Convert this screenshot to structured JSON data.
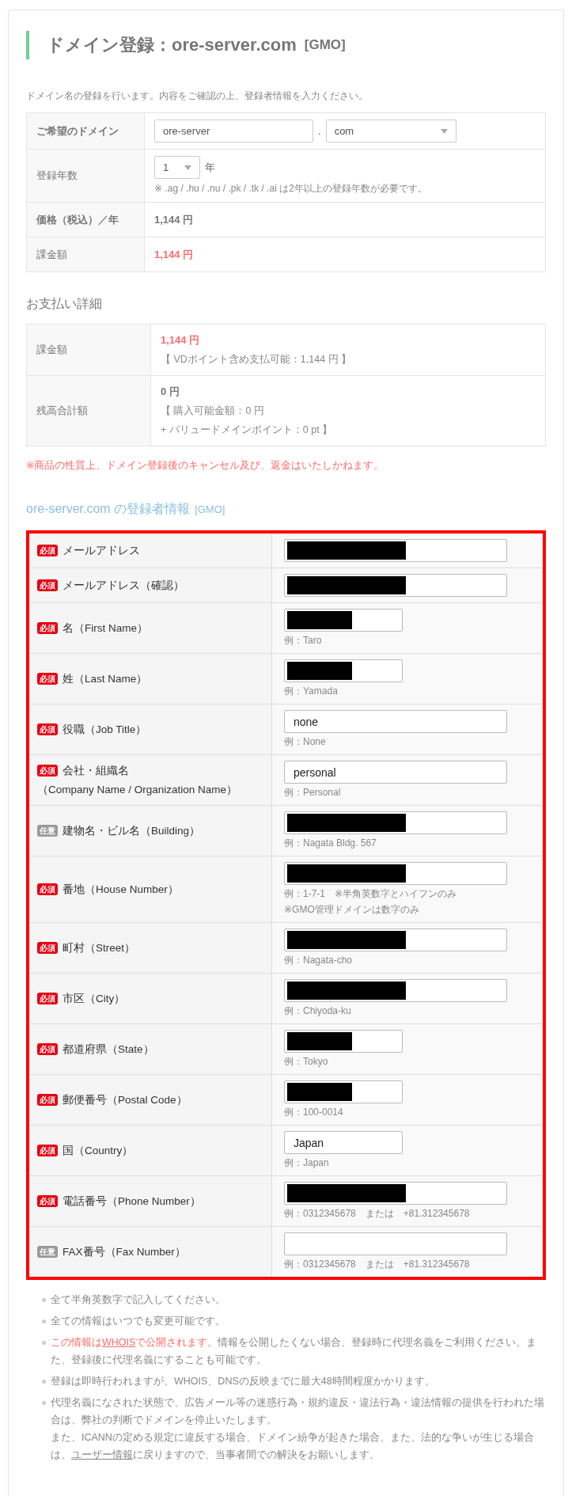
{
  "title": {
    "text": "ドメイン登録：ore-server.com",
    "tag": "[GMO]"
  },
  "intro": "ドメイン名の登録を行います。内容をご確認の上、登録者情報を入力ください。",
  "domain_table": {
    "rows": [
      {
        "kind": "domain",
        "label": "ご希望のドメイン",
        "label_bold": true,
        "name_value": "ore-server",
        "separator": ".",
        "tld_value": "com"
      },
      {
        "kind": "years",
        "label": "登録年数",
        "label_bold": false,
        "value": "1",
        "unit": "年",
        "note": "※ .ag / .hu / .nu / .pk / .tk / .ai は2年以上の登録年数が必要です。"
      },
      {
        "kind": "price",
        "label": "価格（税込）／年",
        "label_bold": true,
        "value": "1,144 円"
      },
      {
        "kind": "charge",
        "label": "課金額",
        "label_bold": false,
        "value": "1,144 円"
      }
    ]
  },
  "payment": {
    "heading": "お支払い詳細",
    "rows": [
      {
        "label": "課金額",
        "lines": [
          {
            "kind": "alert-amount",
            "text": "1,144 円"
          },
          {
            "kind": "detail",
            "text": "【 VDポイント含め支払可能：1,144 円 】"
          }
        ]
      },
      {
        "label": "残高合計額",
        "lines": [
          {
            "kind": "amount",
            "text": "0 円"
          },
          {
            "kind": "detail",
            "text": "【 購入可能金額：0 円"
          },
          {
            "kind": "detail",
            "text": "+ バリュードメインポイント：0 pt 】"
          }
        ]
      }
    ]
  },
  "warning": "※商品の性質上、ドメイン登録後のキャンセル及び、返金はいたしかねます。",
  "registrant": {
    "heading": "ore-server.com の登録者情報",
    "tag": "[GMO]",
    "fields": [
      {
        "badge": "必須",
        "required": true,
        "label": "メールアドレス",
        "kind": "long",
        "redacted": true
      },
      {
        "badge": "必須",
        "required": true,
        "label": "メールアドレス（確認）",
        "kind": "long",
        "redacted": true
      },
      {
        "badge": "必須",
        "required": true,
        "label": "名（First Name）",
        "kind": "short",
        "redacted": true,
        "hints": [
          "例：Taro"
        ]
      },
      {
        "badge": "必須",
        "required": true,
        "label": "姓（Last Name）",
        "kind": "short",
        "redacted": true,
        "hints": [
          "例：Yamada"
        ]
      },
      {
        "badge": "必須",
        "required": true,
        "label": "役職（Job Title）",
        "kind": "long",
        "redacted": false,
        "value": "none",
        "hints": [
          "例：None"
        ]
      },
      {
        "badge": "必須",
        "required": true,
        "label": "会社・組織名",
        "label_2": "（Company Name / Organization Name）",
        "kind": "long",
        "redacted": false,
        "value": "personal",
        "hints": [
          "例：Personal"
        ]
      },
      {
        "badge": "任意",
        "required": false,
        "label": "建物名・ビル名（Building）",
        "kind": "long",
        "redacted": true,
        "hints": [
          "例：Nagata Bldg. 567"
        ]
      },
      {
        "badge": "必須",
        "required": true,
        "label": "番地（House Number）",
        "kind": "long",
        "redacted": true,
        "hints": [
          "例：1-7-1　※半角英数字とハイフンのみ",
          "※GMO管理ドメインは数字のみ"
        ]
      },
      {
        "badge": "必須",
        "required": true,
        "label": "町村（Street）",
        "kind": "long",
        "redacted": true,
        "hints": [
          "例：Nagata-cho"
        ]
      },
      {
        "badge": "必須",
        "required": true,
        "label": "市区（City）",
        "kind": "long",
        "redacted": true,
        "hints": [
          "例：Chiyoda-ku"
        ]
      },
      {
        "badge": "必須",
        "required": true,
        "label": "都道府県（State）",
        "kind": "short",
        "redacted": true,
        "hints": [
          "例：Tokyo"
        ]
      },
      {
        "badge": "必須",
        "required": true,
        "label": "郵便番号（Postal Code）",
        "kind": "short",
        "redacted": true,
        "hints": [
          "例：100-0014"
        ]
      },
      {
        "badge": "必須",
        "required": true,
        "label": "国（Country）",
        "kind": "short",
        "redacted": false,
        "value": "Japan",
        "hints": [
          "例：Japan"
        ]
      },
      {
        "badge": "必須",
        "required": true,
        "label": "電話番号（Phone Number）",
        "kind": "long",
        "redacted": true,
        "hints": [
          "例：0312345678　または　+81.312345678"
        ]
      },
      {
        "badge": "任意",
        "required": false,
        "label": "FAX番号（Fax Number）",
        "kind": "long",
        "redacted": false,
        "hints": [
          "例：0312345678　または　+81.312345678"
        ]
      }
    ]
  },
  "notes": [
    {
      "paragraphs": [
        [
          {
            "kind": "plain",
            "text": "全て半角英数字で記入してください。"
          }
        ]
      ]
    },
    {
      "paragraphs": [
        [
          {
            "kind": "plain",
            "text": "全ての情報はいつでも変更可能です。"
          }
        ]
      ]
    },
    {
      "paragraphs": [
        [
          {
            "kind": "alert",
            "text": "この情報は"
          },
          {
            "kind": "alert-link",
            "text": "WHOIS"
          },
          {
            "kind": "alert",
            "text": "で公開されます。"
          },
          {
            "kind": "plain",
            "text": "情報を公開したくない場合、登録時に代理名義をご利用ください。また、登録後に代理名義にすることも可能です。"
          }
        ]
      ]
    },
    {
      "paragraphs": [
        [
          {
            "kind": "plain",
            "text": "登録は即時行われますが、WHOIS、DNSの反映までに最大48時間程度かかります。"
          }
        ]
      ]
    },
    {
      "paragraphs": [
        [
          {
            "kind": "plain",
            "text": "代理名義になされた状態で、広告メール等の迷惑行為・規約違反・違法行為・違法情報の提供を行われた場合は、弊社の判断でドメインを停止いたします。"
          }
        ],
        [
          {
            "kind": "plain",
            "text": "また、ICANNの定める規定に違反する場合、ドメイン紛争が起きた場合、また、法的な争いが生じる場合は、"
          },
          {
            "kind": "link",
            "text": "ユーザー情報"
          },
          {
            "kind": "plain",
            "text": "に戻りますので、当事者間での解決をお願いします。"
          }
        ]
      ]
    }
  ]
}
